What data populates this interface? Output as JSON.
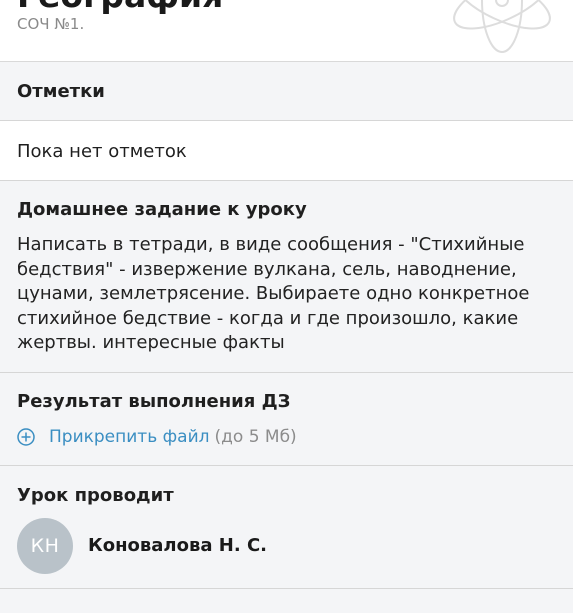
{
  "header": {
    "title": "География",
    "subtitle": "СОЧ №1.",
    "emblem_icon": "atom-icon"
  },
  "marks": {
    "label": "Отметки",
    "empty_text": "Пока нет отметок"
  },
  "homework": {
    "label": "Домашнее задание к уроку",
    "text": "Написать в тетради, в виде сообщения - \"Стихийные бедствия\" - извержение вулкана, сель, наводнение, цунами, землетрясение. Выбираете одно конкретное стихийное бедствие - когда и где произошло, какие жертвы. интересные факты"
  },
  "result": {
    "label": "Результат выполнения ДЗ",
    "attach_icon": "plus-circle-icon",
    "attach_link": "Прикрепить файл",
    "attach_hint": "(до 5 Мб)"
  },
  "teacher": {
    "label": "Урок проводит",
    "initials": "КН",
    "name": "Коновалова Н. С."
  },
  "colors": {
    "accent": "#3a8ec2",
    "avatar_bg": "#b9c2c9",
    "section_gray": "#f4f5f7",
    "divider": "#d6d6d6",
    "muted_text": "#8c8c8c"
  }
}
